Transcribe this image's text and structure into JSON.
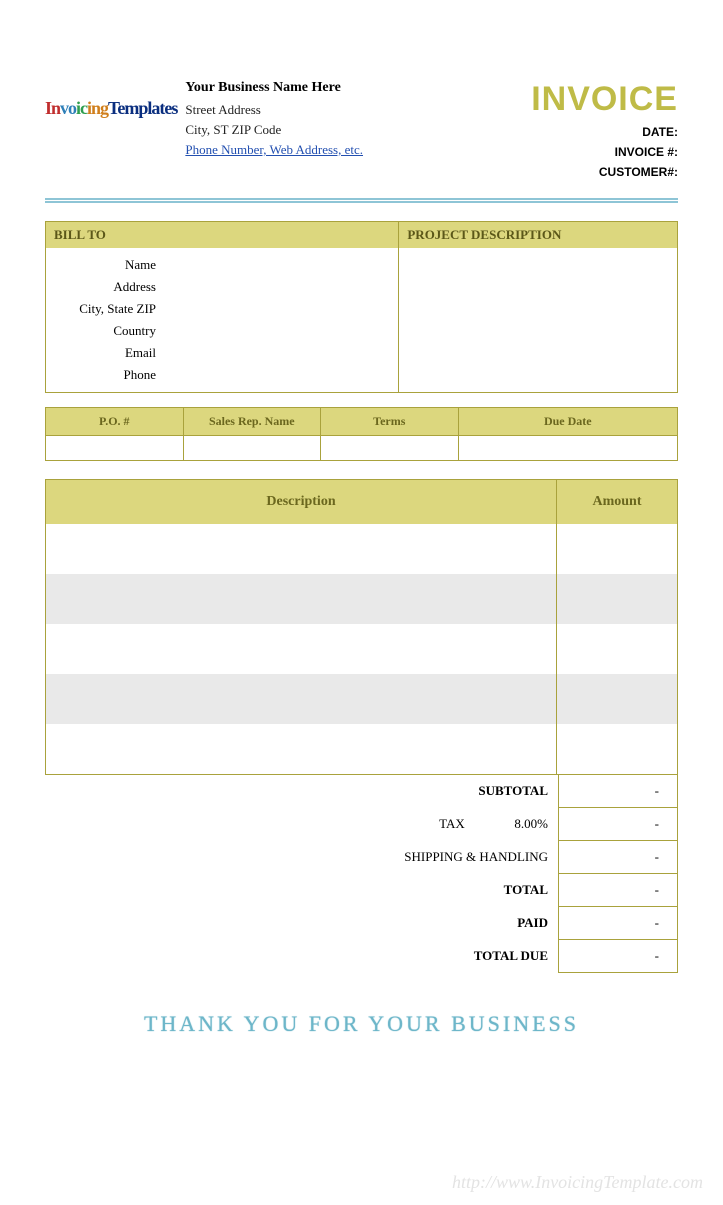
{
  "logo_text": {
    "p1": "Invoicing",
    "p2": "Templates"
  },
  "business": {
    "name": "Your Business Name Here",
    "street": "Street Address",
    "city_line": "City, ST  ZIP Code",
    "contact_link": "Phone Number, Web Address, etc."
  },
  "title": "INVOICE",
  "meta": {
    "date_label": "DATE:",
    "invoice_no_label": "INVOICE #:",
    "customer_no_label": "CUSTOMER#:"
  },
  "billto": {
    "header": "BILL TO",
    "project_header": "PROJECT DESCRIPTION",
    "labels": {
      "name": "Name",
      "address": "Address",
      "csz": "City, State ZIP",
      "country": "Country",
      "email": "Email",
      "phone": "Phone"
    }
  },
  "po": {
    "po_no": "P.O. #",
    "sales_rep": "Sales Rep. Name",
    "terms": "Terms",
    "due_date": "Due Date"
  },
  "items": {
    "desc_header": "Description",
    "amount_header": "Amount"
  },
  "totals": {
    "subtotal_label": "SUBTOTAL",
    "tax_label": "TAX",
    "tax_rate": "8.00%",
    "shipping_label": "SHIPPING & HANDLING",
    "total_label": "TOTAL",
    "paid_label": "PAID",
    "total_due_label": "TOTAL DUE",
    "dash": "-"
  },
  "thank_you": "THANK YOU FOR YOUR BUSINESS",
  "watermark": "http://www.InvoicingTemplate.com"
}
